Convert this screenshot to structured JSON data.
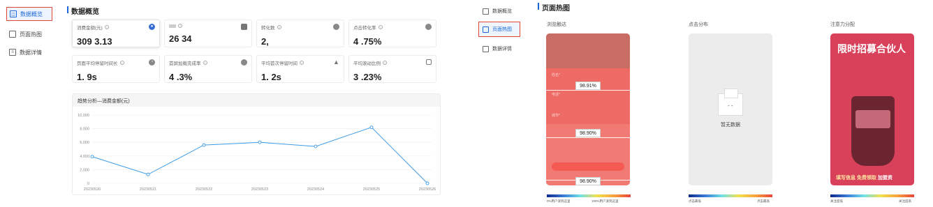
{
  "left_nav": {
    "items": [
      {
        "label": "数据概览",
        "active": true
      },
      {
        "label": "页面热图",
        "active": false
      },
      {
        "label": "数据详情",
        "active": false
      }
    ]
  },
  "overview": {
    "title": "数据概览",
    "cards": [
      {
        "label": "消费金额(元)",
        "value": "309 3.13",
        "icon": "wallet-icon"
      },
      {
        "label": "",
        "value": "26 34",
        "icon": "square-icon"
      },
      {
        "label": "转化数",
        "value": "2,",
        "icon": "circle-icon"
      },
      {
        "label": "点击转化率",
        "value": "4 .75%",
        "icon": "circle-icon"
      },
      {
        "label": "页面平均停留时间长",
        "value": "1. 9s",
        "icon": "clock-icon"
      },
      {
        "label": "首屏加载完成率",
        "value": "4 .3%",
        "icon": "circle-icon"
      },
      {
        "label": "平均首次停留时间",
        "value": "1. 2s",
        "icon": "triangle-icon"
      },
      {
        "label": "平均滚动比例",
        "value": "3 .23%",
        "icon": "square-icon"
      }
    ],
    "trend": {
      "title": "趋势分析—消费金额(元)"
    }
  },
  "chart_data": {
    "type": "line",
    "title": "趋势分析—消费金额(元)",
    "categories": [
      "20230520",
      "20230521",
      "20230522",
      "20230523",
      "20230524",
      "20230525",
      "20230526"
    ],
    "series": [
      {
        "values": [
          3900,
          1300,
          5600,
          6000,
          5400,
          8200,
          0
        ]
      }
    ],
    "ylim": [
      0,
      10000
    ],
    "yticks": [
      "0",
      "2,000",
      "4,000",
      "6,000",
      "8,000",
      "10,000"
    ],
    "grid": true,
    "color": "#3a9ae6"
  },
  "right_nav": {
    "items": [
      {
        "label": "数据概览",
        "active": false
      },
      {
        "label": "页面热图",
        "active": true
      },
      {
        "label": "数据详情",
        "active": false
      }
    ]
  },
  "heatmap": {
    "title": "页面热图",
    "columns": [
      {
        "title": "浏览触达",
        "badges": [
          "98.91%",
          "98.90%",
          "98.90%"
        ],
        "legend_left": "0%用户滚到这里",
        "legend_right": "100%用户滚到这里"
      },
      {
        "title": "点击分布",
        "empty_text": "暂无数据",
        "legend_left": "点击最低",
        "legend_right": "点击最高"
      },
      {
        "title": "注意力分配",
        "headline": "限时招募合伙人",
        "footer_a": "填写信息",
        "footer_b": "免费领取",
        "footer_c": "加盟资",
        "legend_left": "关注度低",
        "legend_right": "关注度高"
      }
    ]
  },
  "colors": {
    "accent": "#1a67d8",
    "highlight_border": "#e2473a",
    "heat": "#f17a74"
  }
}
